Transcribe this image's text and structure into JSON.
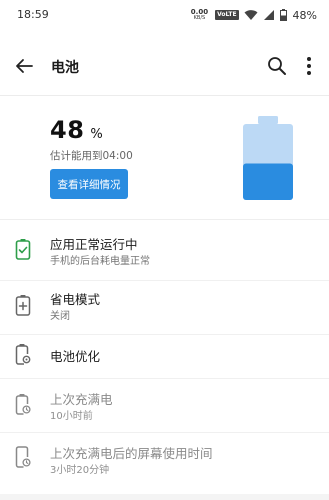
{
  "status_bar": {
    "time": "18:59",
    "net_speed_value": "0.00",
    "net_speed_unit": "KB/S",
    "volte": "VoLTE",
    "battery_pct": "48%"
  },
  "app_bar": {
    "title": "电池",
    "icons": [
      "back-arrow-icon",
      "search-icon",
      "more-vert-icon"
    ]
  },
  "battery": {
    "level_value": "48",
    "level_unit": "%",
    "estimate": "估计能用到04:00",
    "detail_button": "查看详细情况",
    "level_fraction": 0.48,
    "colors": {
      "filled": "#2a8ce0",
      "empty": "#bcd9f5"
    }
  },
  "items": [
    {
      "icon": "battery-check-icon",
      "title": "应用正常运行中",
      "subtitle": "手机的后台耗电量正常",
      "muted": false
    },
    {
      "icon": "battery-plus-icon",
      "title": "省电模式",
      "subtitle": "关闭",
      "muted": false
    },
    {
      "icon": "battery-optimize-icon",
      "title": "电池优化",
      "subtitle": "",
      "muted": false
    },
    {
      "icon": "battery-clock-icon",
      "title": "上次充满电",
      "subtitle": "10小时前",
      "muted": true
    },
    {
      "icon": "screen-time-icon",
      "title": "上次充满电后的屏幕使用时间",
      "subtitle": "3小时20分钟",
      "muted": true
    }
  ]
}
